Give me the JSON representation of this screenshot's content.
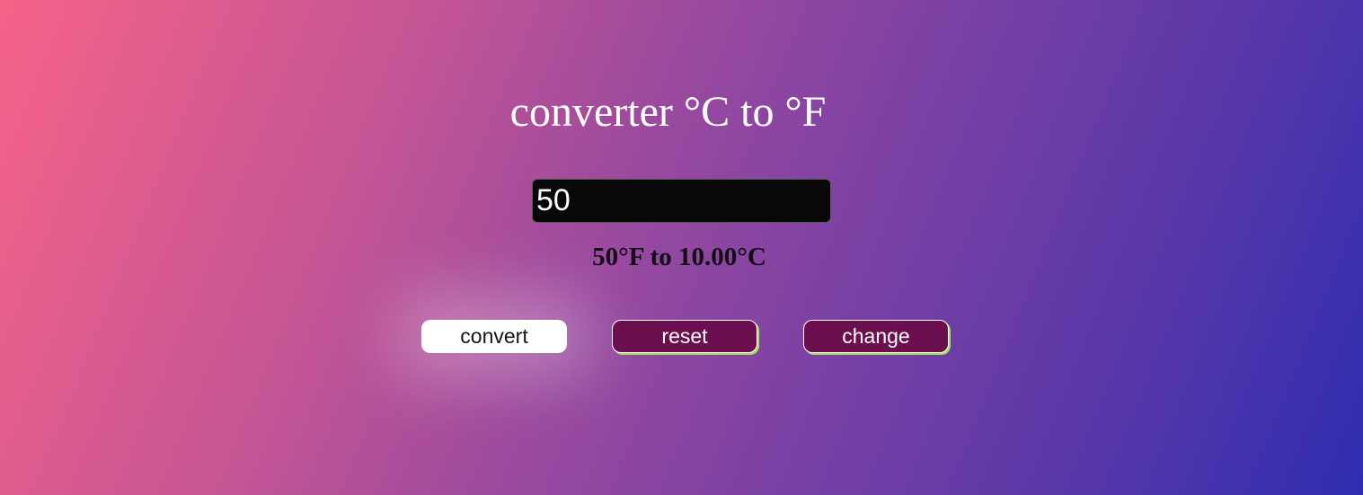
{
  "header": {
    "title": "converter °C to °F"
  },
  "input": {
    "value": "50",
    "placeholder": ""
  },
  "result": {
    "text": "50°F to 10.00°C"
  },
  "buttons": {
    "convert_label": "convert",
    "reset_label": "reset",
    "change_label": "change"
  },
  "colors": {
    "button_primary": "#ffffff",
    "button_secondary": "#6b0f4e",
    "button_shadow": "#a8e05c",
    "input_background": "#080808"
  }
}
